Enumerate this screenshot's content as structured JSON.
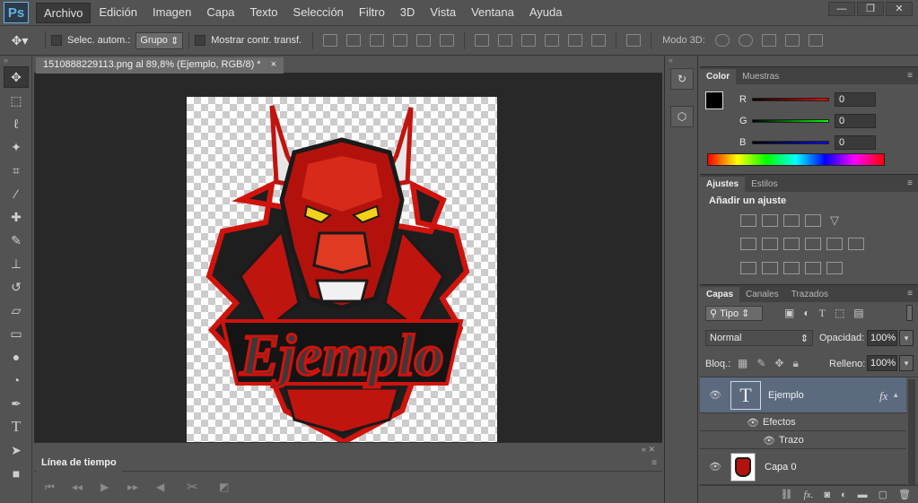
{
  "app": {
    "logo": "Ps"
  },
  "menu": [
    "Archivo",
    "Edición",
    "Imagen",
    "Capa",
    "Texto",
    "Selección",
    "Filtro",
    "3D",
    "Vista",
    "Ventana",
    "Ayuda"
  ],
  "window_controls": {
    "minimize": "—",
    "restore": "❐",
    "close": "✕"
  },
  "options_bar": {
    "auto_select_label": "Selec. autom.:",
    "auto_select_target": "Grupo",
    "show_transform_label": "Mostrar contr. transf.",
    "mode3d_label": "Modo 3D:"
  },
  "document_tab": {
    "title": "1510888229113.png al 89,8% (Ejemplo, RGB/8) *",
    "close": "×"
  },
  "artwork": {
    "text": "Ejemplo"
  },
  "timeline": {
    "title": "Línea de tiempo"
  },
  "color_panel": {
    "tabs": [
      "Color",
      "Muestras"
    ],
    "r_label": "R",
    "g_label": "G",
    "b_label": "B",
    "r_value": "0",
    "g_value": "0",
    "b_value": "0"
  },
  "adjust_panel": {
    "tabs": [
      "Ajustes",
      "Estilos"
    ],
    "heading": "Añadir un ajuste"
  },
  "layers_panel": {
    "tabs": [
      "Capas",
      "Canales",
      "Trazados"
    ],
    "filter_kind": "Tipo",
    "blend_mode": "Normal",
    "opacity_label": "Opacidad:",
    "opacity_value": "100%",
    "lock_label": "Bloq.:",
    "fill_label": "Relleno:",
    "fill_value": "100%",
    "layers": [
      {
        "name": "Ejemplo",
        "thumb": "T",
        "fx": "fx"
      },
      {
        "name": "Efectos"
      },
      {
        "name": "Trazo"
      },
      {
        "name": "Capa 0"
      }
    ]
  },
  "colors": {
    "accent": "#62b5e8",
    "selected_layer": "#5b6a7f",
    "bull_red": "#c0140e"
  }
}
